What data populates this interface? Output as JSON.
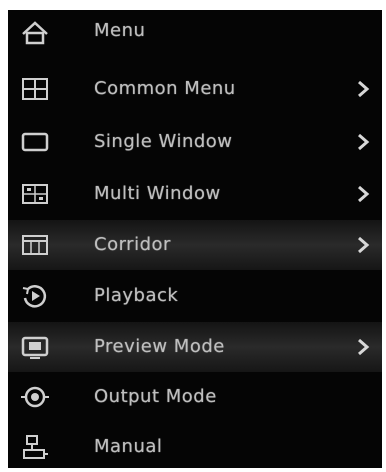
{
  "menu": {
    "title": "Menu",
    "items": [
      {
        "label": "Common Menu",
        "icon": "common-menu-icon",
        "has_submenu": true
      },
      {
        "label": "Single Window",
        "icon": "single-window-icon",
        "has_submenu": true
      },
      {
        "label": "Multi Window",
        "icon": "multi-window-icon",
        "has_submenu": true
      },
      {
        "label": "Corridor",
        "icon": "corridor-icon",
        "has_submenu": true
      },
      {
        "label": "Playback",
        "icon": "playback-icon",
        "has_submenu": false
      },
      {
        "label": "Preview Mode",
        "icon": "preview-mode-icon",
        "has_submenu": true
      },
      {
        "label": "Output Mode",
        "icon": "output-mode-icon",
        "has_submenu": false
      },
      {
        "label": "Manual",
        "icon": "manual-icon",
        "has_submenu": false
      }
    ]
  },
  "colors": {
    "background": "#050505",
    "text": "#bfbfbf",
    "highlight": "#2a2a2a"
  }
}
